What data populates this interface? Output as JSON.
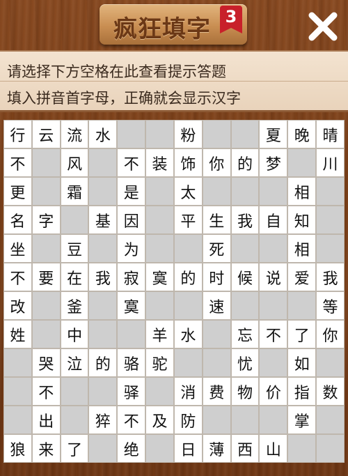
{
  "header": {
    "title": "疯狂填字",
    "level": "3",
    "close_icon": "close-icon"
  },
  "hint": {
    "line1": "请选择下方空格在此查看提示答题",
    "line2": "填入拼音首字母，正确就会显示汉字"
  },
  "colors": {
    "board_background": "#7a4019",
    "blank_cell": "#cfcfcf",
    "letter_cell": "#ffffff",
    "badge": "#c8202a"
  },
  "grid": {
    "rows": [
      [
        "行",
        "云",
        "流",
        "水",
        "",
        "",
        "粉",
        "",
        "",
        "夏",
        "晚",
        "晴"
      ],
      [
        "不",
        "",
        "风",
        "",
        "不",
        "装",
        "饰",
        "你",
        "的",
        "梦",
        "",
        "川"
      ],
      [
        "更",
        "",
        "霜",
        "",
        "是",
        "",
        "太",
        "",
        "",
        "",
        "相",
        ""
      ],
      [
        "名",
        "字",
        "",
        "基",
        "因",
        "",
        "平",
        "生",
        "我",
        "自",
        "知",
        ""
      ],
      [
        "坐",
        "",
        "豆",
        "",
        "为",
        "",
        "",
        "死",
        "",
        "",
        "相",
        ""
      ],
      [
        "不",
        "要",
        "在",
        "我",
        "寂",
        "寞",
        "的",
        "时",
        "候",
        "说",
        "爱",
        "我"
      ],
      [
        "改",
        "",
        "釜",
        "",
        "寞",
        "",
        "",
        "速",
        "",
        "",
        "",
        "等"
      ],
      [
        "姓",
        "",
        "中",
        "",
        "",
        "羊",
        "水",
        "",
        "忘",
        "不",
        "了",
        "你"
      ],
      [
        "",
        "哭",
        "泣",
        "的",
        "骆",
        "驼",
        "",
        "",
        "忧",
        "",
        "如",
        ""
      ],
      [
        "",
        "不",
        "",
        "",
        "驿",
        "",
        "消",
        "费",
        "物",
        "价",
        "指",
        "数"
      ],
      [
        "",
        "出",
        "",
        "猝",
        "不",
        "及",
        "防",
        "",
        "",
        "",
        "掌",
        ""
      ],
      [
        "狼",
        "来",
        "了",
        "",
        "绝",
        "",
        "日",
        "薄",
        "西",
        "山",
        "",
        ""
      ]
    ],
    "mask": [
      "WWWWGGWGGWWW",
      "WGWGWWWWWWGW",
      "WGWGWGWGGGWG",
      "WWGWWGWWWWWG",
      "WGWGWGGWGGWG",
      "WWWWWWWWWWWW",
      "WGWGWGGWGGGW",
      "WGWGGWWGWWWW",
      "GWWWWWGGWGWG",
      "GWGGWGWWWWWW",
      "GWGWWWWGGGWG",
      "WWWGWGWWWWGG"
    ]
  }
}
